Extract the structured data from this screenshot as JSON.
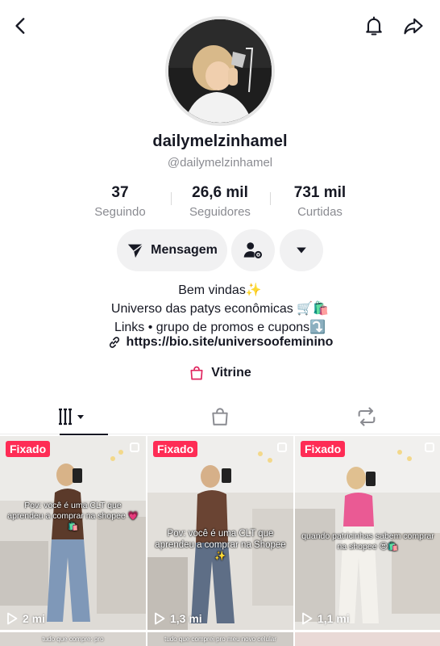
{
  "profile": {
    "username": "dailymelzinhamel",
    "handle": "@dailymelzinhamel"
  },
  "stats": [
    {
      "value": "37",
      "label": "Seguindo"
    },
    {
      "value": "26,6 mil",
      "label": "Seguidores"
    },
    {
      "value": "731 mil",
      "label": "Curtidas"
    }
  ],
  "actions": {
    "message_label": "Mensagem"
  },
  "bio": {
    "lines": [
      "Bem vindas✨",
      "Universo das patys econômicas 🛒🛍️",
      "Links • grupo de promos e cupons⤵️"
    ],
    "link": "https://bio.site/universoofeminino",
    "showcase_label": "Vitrine"
  },
  "icons": {
    "back": "chevron-left-icon",
    "notifications": "bell-icon",
    "share": "share-arrow-icon",
    "message": "send-plane-icon",
    "suggested": "person-gear-icon",
    "more": "caret-down-icon",
    "link": "link-icon",
    "showcase": "shopping-bag-icon",
    "views": "play-outline-icon"
  },
  "colors": {
    "accent": "#fe2c55",
    "text": "#161823",
    "muted": "#8a8b91",
    "button_bg": "#f1f1f2",
    "showcase_icon": "#e0245e"
  },
  "tabs": [
    {
      "name": "videos",
      "icon": "grid-lines-icon",
      "active": true
    },
    {
      "name": "showcase",
      "icon": "shopping-bag-icon",
      "active": false
    },
    {
      "name": "reposts",
      "icon": "repost-icon",
      "active": false
    }
  ],
  "videos": [
    {
      "pinned_label": "Fixado",
      "caption": "Pov: você é uma CLT que aprendeu a comprar na shopee 💗🛍️",
      "views": "2 mi"
    },
    {
      "pinned_label": "Fixado",
      "caption": "Pov: você é uma CLT que aprendeu a comprar na Shopee ✨",
      "views": "1,3 mi"
    },
    {
      "pinned_label": "Fixado",
      "caption": "quando patricinhas sabem comprar na shopee 😍🛍️",
      "views": "1,1 mi"
    }
  ],
  "next_row_captions": [
    "tudo que compre: pro",
    "tudo que comprei pro meu novo celular",
    ""
  ]
}
